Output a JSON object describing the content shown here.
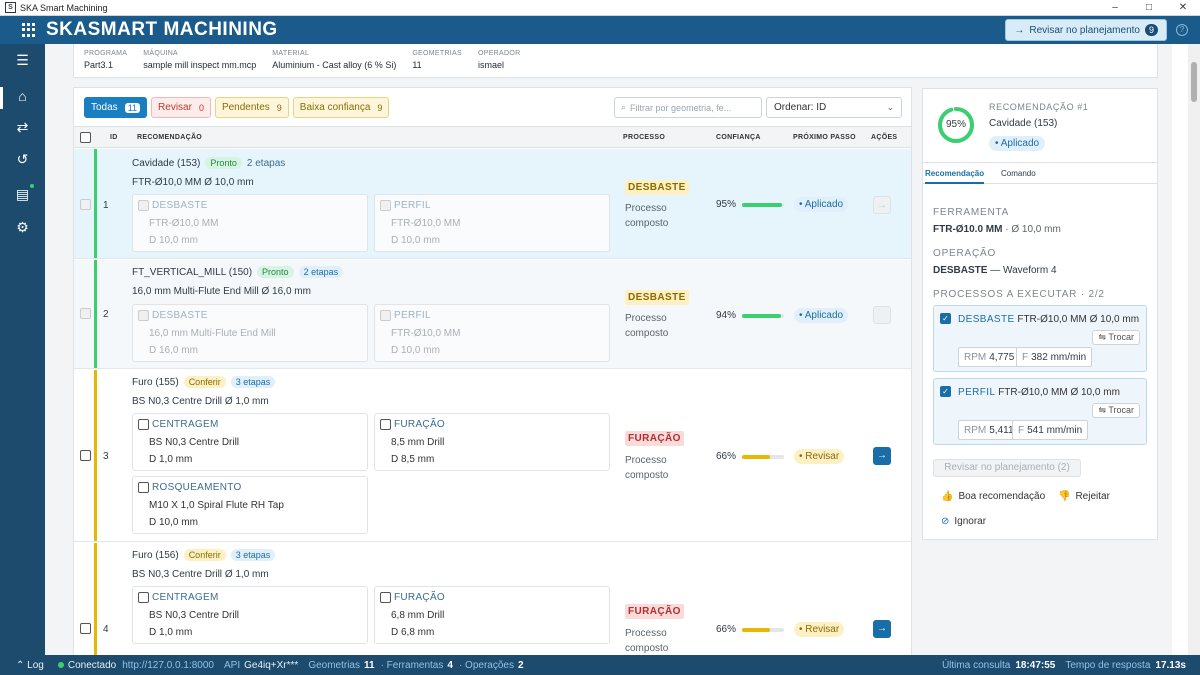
{
  "window": {
    "title": "SKA Smart Machining",
    "min": "–",
    "max": "□",
    "close": "✕"
  },
  "header": {
    "logo": "SKASMART MACHINING",
    "review_button": {
      "label": "Revisar no planejamento",
      "count": "9"
    },
    "help": "?"
  },
  "sidebar": {
    "items": [
      "home-icon",
      "workflow-icon",
      "history-icon",
      "library-icon",
      "settings-icon"
    ]
  },
  "info": [
    {
      "label": "PROGRAMA",
      "value": "Part3.1"
    },
    {
      "label": "MÁQUINA",
      "value": "sample mill inspect mm.mcp"
    },
    {
      "label": "MATERIAL",
      "value": "Aluminium - Cast alloy (6 % Si)"
    },
    {
      "label": "GEOMETRIAS",
      "value": "11"
    },
    {
      "label": "OPERADOR",
      "value": "ismael"
    }
  ],
  "filters": [
    {
      "label": "Todas",
      "count": "11"
    },
    {
      "label": "Revisar",
      "count": "0"
    },
    {
      "label": "Pendentes",
      "count": "9"
    },
    {
      "label": "Baixa confiança",
      "count": "9"
    }
  ],
  "search": {
    "placeholder": "Filtrar por geometria, fe..."
  },
  "order": {
    "label": "Ordenar: ID"
  },
  "table": {
    "headers": {
      "id": "ID",
      "rec": "RECOMENDAÇÃO",
      "proc": "PROCESSO",
      "conf": "CONFIANÇA",
      "next": "PRÓXIMO PASSO",
      "act": "AÇÕES"
    },
    "rows": [
      {
        "id": "1",
        "geometry": "Cavidade (153)",
        "status": "Pronto",
        "steps": "2 etapas",
        "tool": "FTR-Ø10,0 MM",
        "tool_dim": "Ø 10,0 mm",
        "cards": [
          {
            "name": "DESBASTE",
            "tool": "FTR-Ø10,0 MM",
            "dim": "D 10,0 mm"
          },
          {
            "name": "PERFIL",
            "tool": "FTR-Ø10,0 MM",
            "dim": "D 10,0 mm"
          }
        ],
        "process": "DESBASTE",
        "process_type": "Processo composto",
        "confidence": "95%",
        "confidence_value": 0.95,
        "next": "Aplicado"
      },
      {
        "id": "2",
        "geometry": "FT_VERTICAL_MILL (150)",
        "status": "Pronto",
        "steps": "2 etapas",
        "tool": "16,0 mm Multi-Flute End Mill",
        "tool_dim": "Ø 16,0 mm",
        "cards": [
          {
            "name": "DESBASTE",
            "tool": "16,0 mm Multi-Flute End Mill",
            "dim": "D 16,0 mm"
          },
          {
            "name": "PERFIL",
            "tool": "FTR-Ø10,0 MM",
            "dim": "D 10,0 mm"
          }
        ],
        "process": "DESBASTE",
        "process_type": "Processo composto",
        "confidence": "94%",
        "confidence_value": 0.94,
        "next": "Aplicado"
      },
      {
        "id": "3",
        "geometry": "Furo (155)",
        "status": "Conferir",
        "steps": "3 etapas",
        "tool": "BS N0,3 Centre Drill",
        "tool_dim": "Ø 1,0 mm",
        "cards": [
          {
            "name": "CENTRAGEM",
            "tool": "BS N0,3 Centre Drill",
            "dim": "D 1,0 mm"
          },
          {
            "name": "FURAÇÃO",
            "tool": "8,5 mm Drill",
            "dim": "D 8,5 mm"
          },
          {
            "name": "ROSQUEAMENTO",
            "tool": "M10 X 1,0 Spiral Flute RH Tap",
            "dim": "D 10,0 mm"
          }
        ],
        "process": "FURAÇÃO",
        "process_type": "Processo composto",
        "confidence": "66%",
        "confidence_value": 0.66,
        "next": "Revisar"
      },
      {
        "id": "4",
        "geometry": "Furo (156)",
        "status": "Conferir",
        "steps": "3 etapas",
        "tool": "BS N0,3 Centre Drill",
        "tool_dim": "Ø 1,0 mm",
        "cards": [
          {
            "name": "CENTRAGEM",
            "tool": "BS N0,3 Centre Drill",
            "dim": "D 1,0 mm"
          },
          {
            "name": "FURAÇÃO",
            "tool": "6,8 mm Drill",
            "dim": "D 6,8 mm"
          }
        ],
        "process": "FURAÇÃO",
        "process_type": "Processo composto",
        "confidence": "66%",
        "confidence_value": 0.66,
        "next": "Revisar"
      }
    ]
  },
  "recommendation": {
    "confidence": "95%",
    "confidence_value": 0.95,
    "title": "RECOMENDAÇÃO #1",
    "geometry": "Cavidade (153)",
    "state": "Aplicado",
    "tabs": [
      "Recomendação",
      "Comando"
    ],
    "tool_label": "FERRAMENTA",
    "tool": "FTR-Ø10.0 MM",
    "tool_dim": "· Ø 10,0 mm",
    "op_label": "OPERAÇÃO",
    "op": "DESBASTE",
    "op_detail": "— Waveform 4",
    "proc_label": "PROCESSOS A EXECUTAR · 2/2",
    "processes": [
      {
        "name": "DESBASTE",
        "tool": "FTR-Ø10,0 MM",
        "dim": "Ø 10,0 mm",
        "swap": "Trocar",
        "rpm_label": "RPM",
        "rpm": "4,775",
        "f_label": "F",
        "f": "382 mm/min"
      },
      {
        "name": "PERFIL",
        "tool": "FTR-Ø10,0 MM",
        "dim": "Ø 10,0 mm",
        "swap": "Trocar",
        "rpm_label": "RPM",
        "rpm": "5,411",
        "f_label": "F",
        "f": "541 mm/min"
      }
    ],
    "review_btn": "Revisar no planejamento (2)",
    "good": "Boa recomendação",
    "reject": "Rejeitar",
    "ignore": "Ignorar"
  },
  "status": {
    "log": "Log",
    "connected": "Conectado",
    "url": "http://127.0.0.1:8000",
    "api_label": "API",
    "api": "Ge4iq+Xr***",
    "geo_label": "Geometrias",
    "geo": "11",
    "tools_label": "· Ferramentas",
    "tools": "4",
    "ops_label": "· Operações",
    "ops": "2",
    "last_label": "Última consulta",
    "last": "18:47:55",
    "resp_label": "Tempo de resposta",
    "resp": "17.13s"
  },
  "colors": {
    "accent": "#1a6ea8",
    "header": "#1a5b8c",
    "ok": "#3ccf70",
    "warn": "#e6b800"
  }
}
